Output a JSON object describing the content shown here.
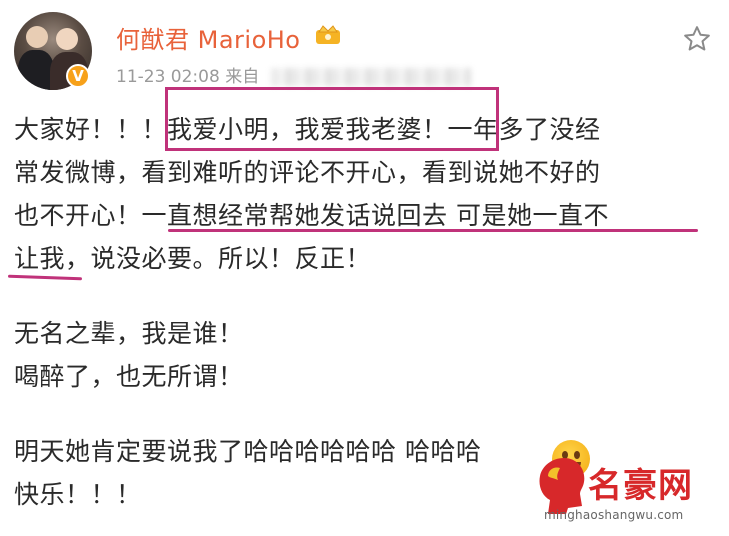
{
  "profile": {
    "username": "何猷君 MarioHo",
    "timestamp": "11-23 02:08",
    "source_prefix": "来自",
    "verified_badge": "V"
  },
  "post": {
    "lines": [
      "大家好！！！我爱小明，我爱我老婆！一年多了没经",
      "常发微博，看到难听的评论不开心，看到说她不好的",
      "也不开心！一直想经常帮她发话说回去 可是她一直不",
      "让我，说没必要。所以！反正！",
      "",
      "无名之辈，我是谁！",
      "喝醉了，也无所谓！",
      "",
      "明天她肯定要说我了哈哈哈哈哈哈 哈哈哈",
      "快乐！！！"
    ]
  },
  "watermark": {
    "brand": "名豪网",
    "url": "minghaoshangwu.com"
  },
  "colors": {
    "username": "#e8623a",
    "highlight": "#c0327a",
    "watermark": "#d7282a"
  },
  "icons": {
    "favorite": "star-outline-icon",
    "member": "crown-member-icon"
  }
}
